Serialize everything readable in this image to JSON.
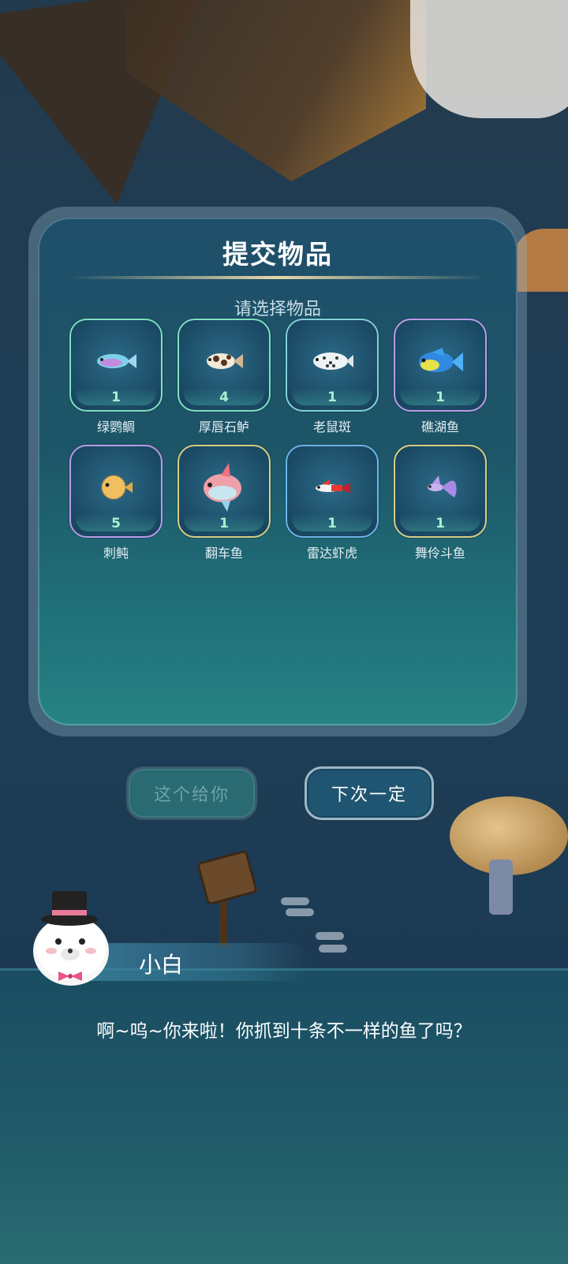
{
  "panel": {
    "title": "提交物品",
    "subtitle": "请选择物品",
    "items": [
      {
        "name": "绿鹦鲷",
        "count": "1",
        "icon": "green-parrotfish-icon",
        "frame": "green"
      },
      {
        "name": "厚唇石鲈",
        "count": "4",
        "icon": "sweetlips-fish-icon",
        "frame": "green"
      },
      {
        "name": "老鼠斑",
        "count": "1",
        "icon": "mouse-grouper-icon",
        "frame": "teal"
      },
      {
        "name": "礁湖鱼",
        "count": "1",
        "icon": "lagoon-fish-icon",
        "frame": "purple"
      },
      {
        "name": "刺鲀",
        "count": "5",
        "icon": "pufferfish-icon",
        "frame": "purple"
      },
      {
        "name": "翻车鱼",
        "count": "1",
        "icon": "sunfish-icon",
        "frame": "gold"
      },
      {
        "name": "雷达虾虎",
        "count": "1",
        "icon": "goby-fish-icon",
        "frame": "blue"
      },
      {
        "name": "舞伶斗鱼",
        "count": "1",
        "icon": "betta-fish-icon",
        "frame": "gold"
      }
    ]
  },
  "buttons": {
    "give_label": "这个给你",
    "next_label": "下次一定"
  },
  "dialog": {
    "speaker": "小白",
    "text": "啊~呜~你来啦！你抓到十条不一样的鱼了吗？"
  }
}
